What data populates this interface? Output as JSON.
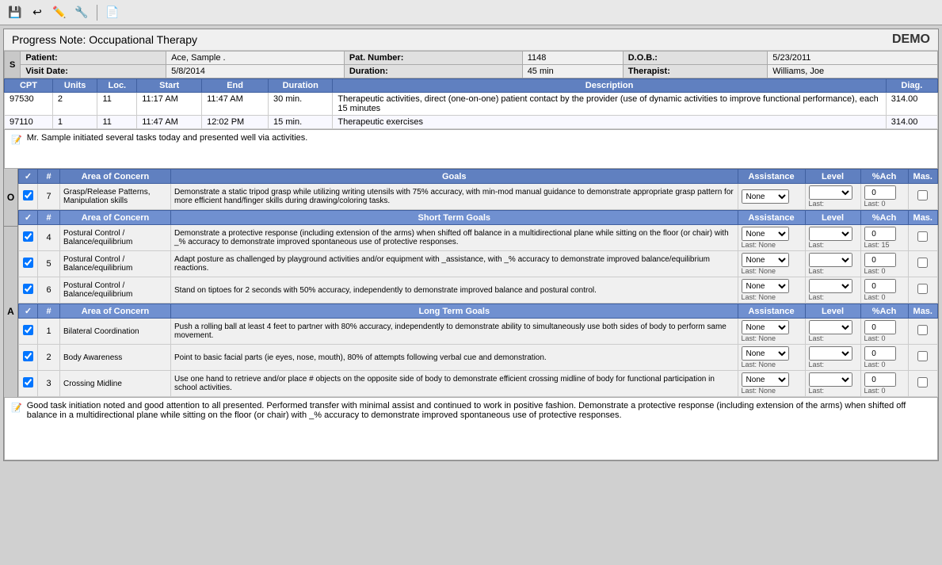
{
  "toolbar": {
    "icons": [
      "💾",
      "↩",
      "✏️",
      "🔧",
      "📄"
    ]
  },
  "header": {
    "title": "Progress Note:",
    "subtitle": "Occupational Therapy",
    "demo": "DEMO"
  },
  "patient": {
    "label": "Patient:",
    "name": "Ace, Sample .",
    "pat_number_label": "Pat. Number:",
    "pat_number": "1148",
    "dob_label": "D.O.B.:",
    "dob": "5/23/2011",
    "visit_date_label": "Visit Date:",
    "visit_date": "5/8/2014",
    "duration_label": "Duration:",
    "duration": "45 min",
    "therapist_label": "Therapist:",
    "therapist": "Williams, Joe"
  },
  "cpt_headers": [
    "CPT",
    "Units",
    "Loc.",
    "Start",
    "End",
    "Duration",
    "Description",
    "Diag."
  ],
  "cpt_rows": [
    {
      "cpt": "97530",
      "units": "2",
      "loc": "11",
      "start": "11:17 AM",
      "end": "11:47 AM",
      "duration": "30 min.",
      "description": "Therapeutic activities, direct (one-on-one) patient contact by the provider (use of dynamic activities to improve functional performance), each 15 minutes",
      "diag": "314.00"
    },
    {
      "cpt": "97110",
      "units": "1",
      "loc": "11",
      "start": "11:47 AM",
      "end": "12:02 PM",
      "duration": "15 min.",
      "description": "Therapeutic exercises",
      "diag": "314.00"
    }
  ],
  "narrative_s": "Mr. Sample initiated several tasks today and presented well via activities.",
  "long_term_goals_label": "Long Term Goals",
  "short_term_goals_label": "Short Term Goals",
  "goals_columns": {
    "hash": "#",
    "area": "Area of Concern",
    "goals": "Goals",
    "assistance": "Assistance",
    "level": "Level",
    "pct_ach": "%Ach",
    "mas": "Mas."
  },
  "long_term_goal_row": {
    "checked": true,
    "num": "7",
    "area": "Grasp/Release Patterns, Manipulation skills",
    "goals": "Demonstrate a static tripod grasp while utilizing writing utensils with 75% accuracy, with min-mod manual guidance to demonstrate appropriate grasp pattern for more efficient hand/finger skills during drawing/coloring tasks.",
    "assistance": "None",
    "assistance_last": "",
    "level_last": "Last:",
    "pct_val": "0",
    "pct_last": "Last: 0",
    "mas_checked": false
  },
  "short_term_rows": [
    {
      "checked": true,
      "num": "4",
      "area": "Postural Control / Balance/equilibrium",
      "goals": "Demonstrate a protective response (including extension of the arms) when shifted off balance in a multidirectional plane while sitting on the floor (or chair) with _% accuracy to demonstrate improved spontaneous use of protective responses.",
      "assistance": "None",
      "assistance_last": "Last: None",
      "level_last": "Last:",
      "pct_val": "0",
      "pct_last": "Last: 15",
      "mas_checked": false
    },
    {
      "checked": true,
      "num": "5",
      "area": "Postural Control / Balance/equilibrium",
      "goals": "Adapt posture as challenged by playground activities and/or equipment with _assistance, with _% accuracy to demonstrate improved balance/equilibrium reactions.",
      "assistance": "None",
      "assistance_last": "Last: None",
      "level_last": "Last:",
      "pct_val": "0",
      "pct_last": "Last: 0",
      "mas_checked": false
    },
    {
      "checked": true,
      "num": "6",
      "area": "Postural Control / Balance/equilibrium",
      "goals": "Stand on tiptoes for 2 seconds with 50% accuracy, independently to demonstrate improved balance and postural control.",
      "assistance": "None",
      "assistance_last": "Last: None",
      "level_last": "Last:",
      "pct_val": "0",
      "pct_last": "Last: 0",
      "mas_checked": false
    }
  ],
  "long_term_rows_bottom": [
    {
      "checked": true,
      "num": "1",
      "area": "Bilateral Coordination",
      "goals": "Push a rolling ball at least 4 feet to partner with 80% accuracy, independently to demonstrate ability to simultaneously use both sides of body to perform same movement.",
      "assistance": "None",
      "assistance_last": "Last: None",
      "level_last": "Last:",
      "pct_val": "0",
      "pct_last": "Last: 0",
      "mas_checked": false
    },
    {
      "checked": true,
      "num": "2",
      "area": "Body Awareness",
      "goals": "Point to basic facial parts (ie eyes, nose, mouth), 80% of attempts following verbal cue and demonstration.",
      "assistance": "None",
      "assistance_last": "Last: None",
      "level_last": "Last:",
      "pct_val": "0",
      "pct_last": "Last: 0",
      "mas_checked": false
    },
    {
      "checked": true,
      "num": "3",
      "area": "Crossing Midline",
      "goals": "Use one hand to retrieve and/or place # objects on the opposite side of body to demonstrate efficient crossing midline of body for functional participation in school activities.",
      "assistance": "None",
      "assistance_last": "Last: None",
      "level_last": "Last:",
      "pct_val": "0",
      "pct_last": "Last: 0",
      "mas_checked": false
    }
  ],
  "narrative_o": "Good task initiation noted and good attention to all presented.  Performed transfer with minimal assist and continued to work in positive fashion.  Demonstrate a protective response (including extension of the arms) when shifted off balance in a multidirectional plane while sitting on the floor (or chair) with _% accuracy to demonstrate improved spontaneous use of protective responses."
}
